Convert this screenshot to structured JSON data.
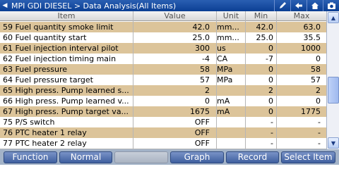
{
  "titlebar": {
    "path": "MPI   GDI   DIESEL > Data Analysis(All Items)",
    "icons": [
      "pen-icon",
      "back-arrow-icon",
      "home-icon",
      "camera-icon"
    ]
  },
  "columns": {
    "item": "Item",
    "value": "Value",
    "unit": "Unit",
    "min": "Min",
    "max": "Max"
  },
  "rows": [
    {
      "item": "59 Fuel quantity smoke limit",
      "value": "42.0",
      "unit": "mm...",
      "min": "42.0",
      "max": "63.0"
    },
    {
      "item": "60 Fuel quantity start",
      "value": "25.0",
      "unit": "mm...",
      "min": "25.0",
      "max": "35.5"
    },
    {
      "item": "61 Fuel injection interval pilot",
      "value": "300",
      "unit": "us",
      "min": "0",
      "max": "1000"
    },
    {
      "item": "62 Fuel injection timing main",
      "value": "-4",
      "unit": "CA",
      "min": "-7",
      "max": "0"
    },
    {
      "item": "63 Fuel pressure",
      "value": "58",
      "unit": "MPa",
      "min": "0",
      "max": "58"
    },
    {
      "item": "64 Fuel pressure target",
      "value": "57",
      "unit": "MPa",
      "min": "0",
      "max": "57"
    },
    {
      "item": "65 High press. Pump learned s...",
      "value": "2",
      "unit": "",
      "min": "2",
      "max": "2"
    },
    {
      "item": "66 High press. Pump learned v...",
      "value": "0",
      "unit": "mA",
      "min": "0",
      "max": "0"
    },
    {
      "item": "67 High press. Pump target va...",
      "value": "1675",
      "unit": "mA",
      "min": "0",
      "max": "1775"
    },
    {
      "item": "75 P/S switch",
      "value": "OFF",
      "unit": "",
      "min": "-",
      "max": "-"
    },
    {
      "item": "76 PTC heater 1 relay",
      "value": "OFF",
      "unit": "",
      "min": "-",
      "max": "-"
    },
    {
      "item": "77 PTC heater 2 relay",
      "value": "OFF",
      "unit": "",
      "min": "-",
      "max": "-"
    }
  ],
  "toolbar": {
    "function": "Function",
    "normal": "Normal",
    "blank": "",
    "graph": "Graph",
    "record": "Record",
    "select_item": "Select Item"
  },
  "colors": {
    "titlebar": "#0b3f94",
    "row_highlight": "#dcc49a",
    "toolbar_button": "#3f5f9f"
  }
}
